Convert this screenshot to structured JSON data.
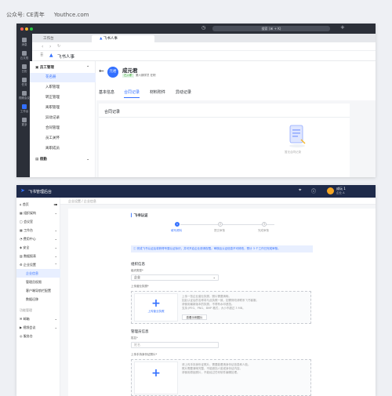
{
  "watermark": {
    "account": "公众号: CE青年",
    "site": "Youthce.com"
  },
  "window1": {
    "search_text": "搜索 (⌘ + K)",
    "tabs": [
      {
        "label": "工作台"
      },
      {
        "label": "飞书人事"
      }
    ],
    "app_title": "飞书人事",
    "sidebar_icons": [
      {
        "label": "消息"
      },
      {
        "label": "云文档"
      },
      {
        "label": "日历"
      },
      {
        "label": "任务"
      },
      {
        "label": "视频会议"
      },
      {
        "label": "工作台"
      },
      {
        "label": "更多"
      }
    ],
    "nav_group": "员工管理",
    "nav_items": [
      {
        "label": "花名册"
      },
      {
        "label": "入职管理"
      },
      {
        "label": "转正管理"
      },
      {
        "label": "离职管理"
      },
      {
        "label": "异动记录"
      },
      {
        "label": "合同管理"
      },
      {
        "label": "员工关怀"
      },
      {
        "label": "离职成员"
      }
    ],
    "nav_group2": "假勤",
    "profile": {
      "avatar": "元君",
      "name": "成元君",
      "tag": "已入职",
      "dept": "第六期学员  在职"
    },
    "profile_tabs": [
      {
        "label": "基本信息"
      },
      {
        "label": "合同记录"
      },
      {
        "label": "材料附件"
      },
      {
        "label": "异动记录"
      }
    ],
    "card_title": "合同记录",
    "empty_text": "暂无合同记录"
  },
  "window2": {
    "app_name": "飞书管理后台",
    "user": "成玩 1",
    "user_sub": "企业 A",
    "menu": [
      {
        "label": "首页"
      },
      {
        "label": "组织架构"
      },
      {
        "label": "会议室"
      },
      {
        "label": "工作台"
      },
      {
        "label": "费用中心"
      },
      {
        "label": "安全"
      },
      {
        "label": "数据报表"
      },
      {
        "label": "企业设置"
      },
      {
        "label": "企业信息"
      },
      {
        "label": "管理员权限"
      },
      {
        "label": "客户端导航栏配置"
      },
      {
        "label": "数据迁移"
      },
      {
        "label": "功能管理"
      },
      {
        "label": "邮箱"
      },
      {
        "label": "视频会议"
      },
      {
        "label": "服务台"
      }
    ],
    "breadcrumb": "企业设置  /  企业信息",
    "section_title": "飞书认证",
    "steps": [
      {
        "label": "填写资料"
      },
      {
        "label": "提交审核"
      },
      {
        "label": "完成审核"
      }
    ],
    "info_banner": "完成飞书认证后将获得专属认证标识，并可开启企业邀请权限。审核后认证信息不可修改，预计 3 个工作日完成审核。",
    "org_title": "组织信息",
    "org_type_label": "组织类型*",
    "org_type_value": "企业",
    "license_label": "上传营业执照*",
    "upload_btn_text": "上传营业执照",
    "license_desc": [
      "上传一张企业营业执照，照片需要清晰。",
      "如此认证后的名称将与此执照一致，如需修改请联系飞书客服。",
      "请使用最新版本的执照，不得有水印遮挡。",
      "支持 JPEG、PNG、BMP 格式，大小不超过 3 MB。"
    ],
    "view_sample": "查看示例图片",
    "admin_title": "管理员信息",
    "name_label": "姓名*",
    "name_placeholder": "姓名",
    "id_label": "上传手持身份证照片*",
    "id_desc": [
      "请上传手持身份证照片，需要能看清身份证信息和人脸。",
      "照片需要清晰完整，不能遮挡人脸或身份证内容。",
      "请使用原始照片，不能经过任何软件编辑处理。"
    ]
  }
}
